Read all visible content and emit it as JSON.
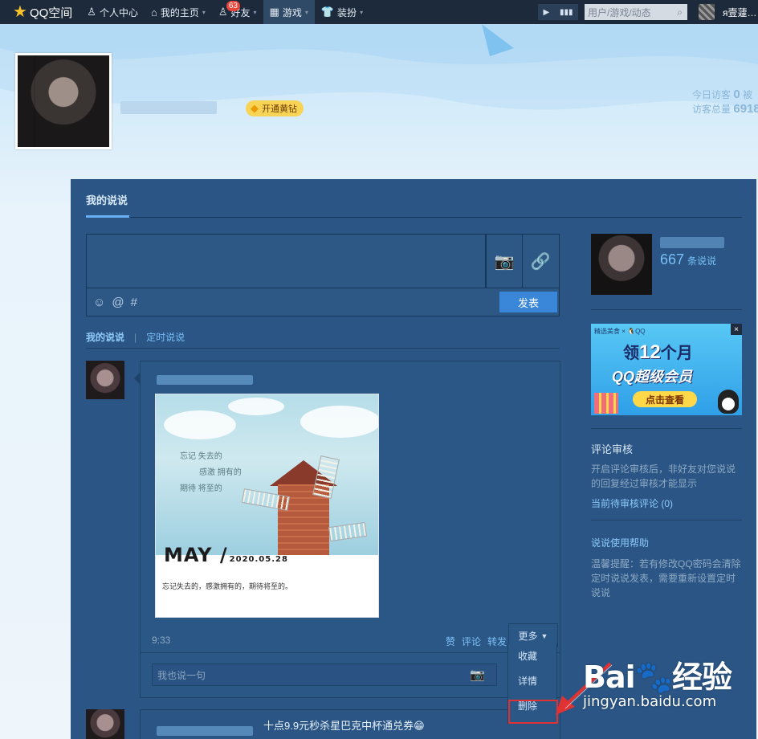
{
  "topbar": {
    "logo": "QQ空间",
    "nav": [
      {
        "label": "个人中心",
        "icon": "person-icon"
      },
      {
        "label": "我的主页",
        "icon": "home-icon"
      },
      {
        "label": "好友",
        "icon": "friends-icon",
        "badge": "63"
      },
      {
        "label": "游戏",
        "icon": "grid-icon"
      },
      {
        "label": "装扮",
        "icon": "shirt-icon"
      }
    ],
    "search_placeholder": "用户/游戏/动态",
    "user_name": "я壹蘧…"
  },
  "header": {
    "vip_label": "开通黄钻",
    "stats_today_label": "今日访客",
    "stats_today_value": "0",
    "stats_today_suffix": "被",
    "stats_total_label": "访客总量",
    "stats_total_value": "6918"
  },
  "panel": {
    "title": "我的说说",
    "post_button": "发表",
    "subtabs": {
      "mine": "我的说说",
      "separator": "|",
      "scheduled": "定时说说"
    }
  },
  "post": {
    "poem": [
      "忘记 失去的",
      "感激 拥有的",
      "期待 将至的"
    ],
    "month": "MAY /",
    "date": "2020.05.28",
    "caption": "忘记失去的，感激拥有的，期待将至的。",
    "time": "9:33",
    "actions": [
      "赞",
      "评论",
      "转发"
    ],
    "more_label": "更多",
    "comment_placeholder": "我也说一句"
  },
  "dropdown": {
    "items": [
      "收藏",
      "详情",
      "删除"
    ]
  },
  "feed2": {
    "text": "十点9.9元秒杀星巴克中杯通兑券😁"
  },
  "right": {
    "count": "667",
    "count_suffix": "条说说",
    "ad": {
      "brand": "精选美食 × 🐧QQ",
      "line1_a": "领",
      "line1_num": "12",
      "line1_b": "个月",
      "line2": "QQ超级会员",
      "button": "点击查看",
      "close": "×"
    },
    "review_title": "评论审核",
    "review_text": "开启评论审核后，非好友对您说说的回复经过审核才能显示",
    "review_link": "当前待审核评论 (0)",
    "help_title": "说说使用帮助",
    "help_text": "温馨提醒：若有修改QQ密码会清除定时说说发表，需要重新设置定时说说"
  },
  "watermark": {
    "big": "Bai🐾经验",
    "small": "jingyan.baidu.com"
  }
}
